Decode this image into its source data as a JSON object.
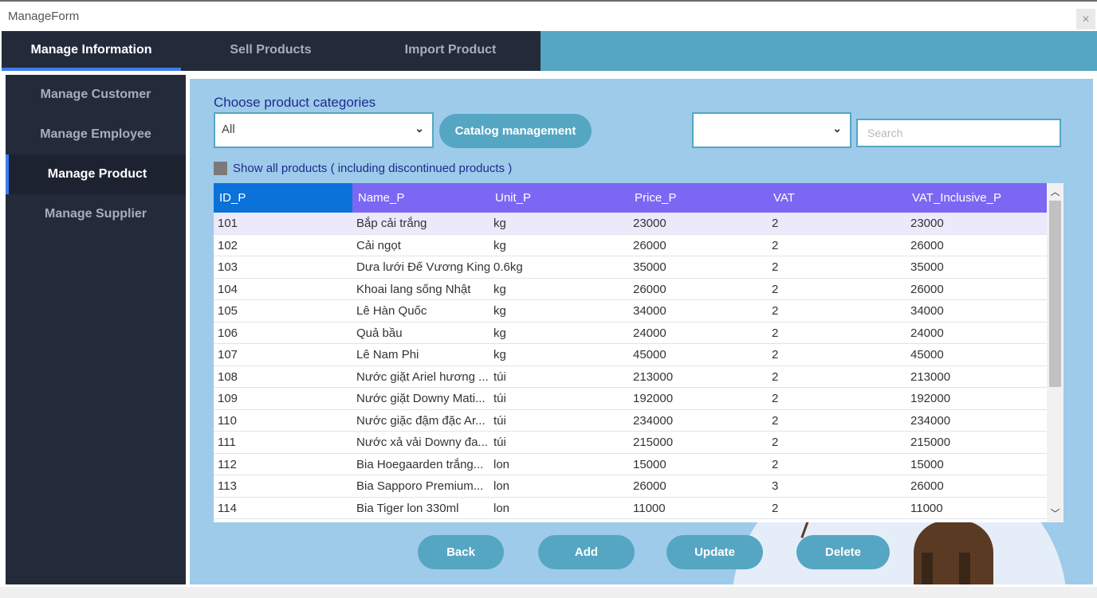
{
  "window": {
    "title": "ManageForm",
    "close_label": "✕"
  },
  "topnav": {
    "tabs": [
      "Manage Information",
      "Sell Products",
      "Import Product"
    ],
    "active": 0
  },
  "sidebar": {
    "items": [
      "Manage Customer",
      "Manage Employee",
      "Manage Product",
      "Manage Supplier"
    ],
    "active": 2
  },
  "filters": {
    "category_label": "Choose product categories",
    "category_value": "All",
    "catalog_button": "Catalog management",
    "search_field_value": "",
    "search_placeholder": "Search",
    "show_all_label": "Show all products ( including discontinued products )"
  },
  "table": {
    "columns": [
      "ID_P",
      "Name_P",
      "Unit_P",
      "Price_P",
      "VAT",
      "VAT_Inclusive_P"
    ],
    "rows": [
      [
        "101",
        "Bắp cải trắng",
        "kg",
        "23000",
        "2",
        "23000"
      ],
      [
        "102",
        "Cải ngọt",
        "kg",
        "26000",
        "2",
        "26000"
      ],
      [
        "103",
        "Dưa lưới Đế Vương King",
        "0.6kg",
        "35000",
        "2",
        "35000"
      ],
      [
        "104",
        "Khoai lang sống Nhật",
        "kg",
        "26000",
        "2",
        "26000"
      ],
      [
        "105",
        "Lê Hàn Quốc",
        "kg",
        "34000",
        "2",
        "34000"
      ],
      [
        "106",
        "Quả bầu",
        "kg",
        "24000",
        "2",
        "24000"
      ],
      [
        "107",
        "Lê Nam Phi",
        "kg",
        "45000",
        "2",
        "45000"
      ],
      [
        "108",
        "Nước giặt Ariel hương ...",
        "túi",
        "213000",
        "2",
        "213000"
      ],
      [
        "109",
        "Nước giặt Downy Mati...",
        "túi",
        "192000",
        "2",
        "192000"
      ],
      [
        "110",
        "Nước giặc đậm đặc Ar...",
        "túi",
        "234000",
        "2",
        "234000"
      ],
      [
        "111",
        "Nước xả vải Downy đa...",
        "túi",
        "215000",
        "2",
        "215000"
      ],
      [
        "112",
        "Bia Hoegaarden trắng...",
        "lon",
        "15000",
        "2",
        "15000"
      ],
      [
        "113",
        "Bia Sapporo Premium...",
        "lon",
        "26000",
        "3",
        "26000"
      ],
      [
        "114",
        "Bia Tiger lon 330ml",
        "lon",
        "11000",
        "2",
        "11000"
      ]
    ],
    "selected_row": 0
  },
  "actions": {
    "back": "Back",
    "add": "Add",
    "update": "Update",
    "delete": "Delete"
  },
  "colors": {
    "nav_dark": "#232b3b",
    "accent_blue": "#3e7cf0",
    "teal": "#55a6c3",
    "header_purple": "#7b67f4",
    "content_bg": "#9ecbea"
  }
}
